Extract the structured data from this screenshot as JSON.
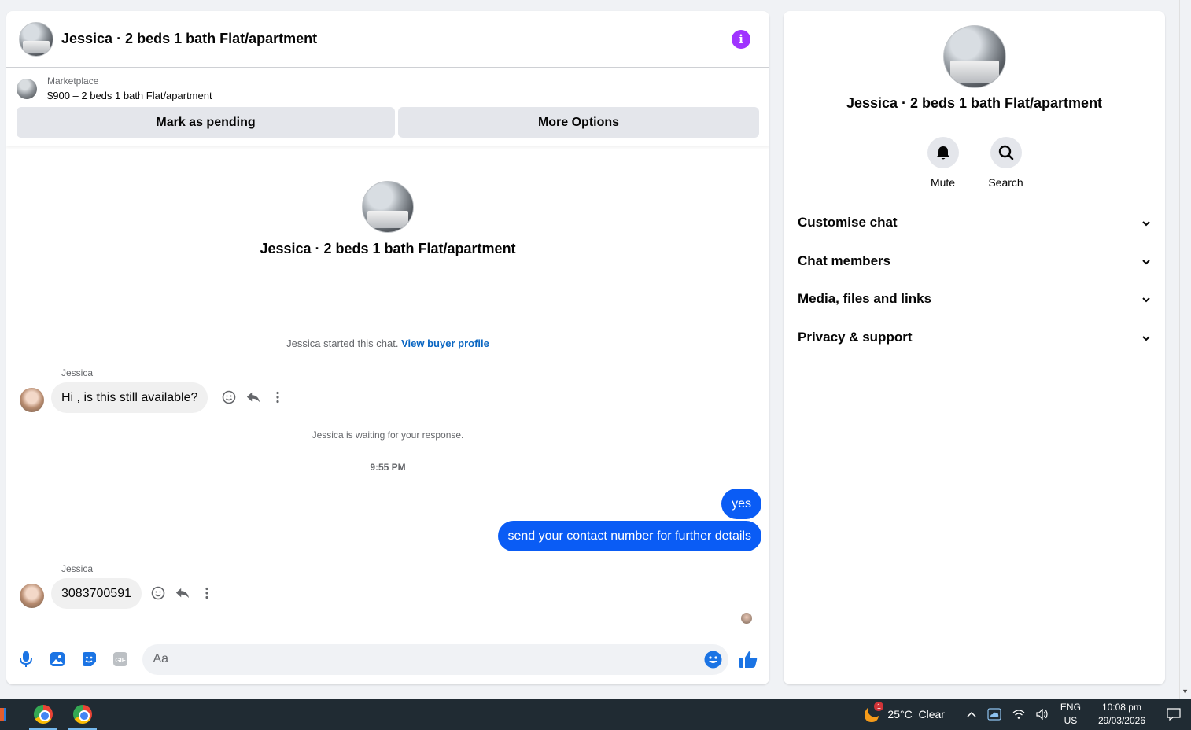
{
  "chat": {
    "title": "Jessica · 2 beds 1 bath Flat/apartment",
    "marketplace": {
      "label": "Marketplace",
      "listing": "$900 – 2 beds 1 bath Flat/apartment",
      "pending_button": "Mark as pending",
      "options_button": "More Options"
    },
    "intro_name": "Jessica · 2 beds 1 bath Flat/apartment",
    "started_text": "Jessica started this chat.",
    "view_profile_link": "View buyer profile",
    "messages": [
      {
        "sender": "Jessica",
        "text": "Hi , is this still available?"
      },
      {
        "sender": "Jessica",
        "text": "3083700591"
      }
    ],
    "waiting_text": "Jessica is waiting for your response.",
    "timestamp": "9:55 PM",
    "outgoing": [
      {
        "text": "yes"
      },
      {
        "text": "send your contact number for further details"
      }
    ],
    "composer_placeholder": "Aa"
  },
  "details": {
    "name": "Jessica · 2 beds 1 bath Flat/apartment",
    "actions": [
      {
        "label": "Mute",
        "icon": "bell-icon"
      },
      {
        "label": "Search",
        "icon": "search-icon"
      }
    ],
    "sections": [
      {
        "label": "Customise chat"
      },
      {
        "label": "Chat members"
      },
      {
        "label": "Media, files and links"
      },
      {
        "label": "Privacy & support"
      }
    ]
  },
  "taskbar": {
    "weather": "25°C  Clear",
    "weather_badge": "1",
    "lang_top": "ENG",
    "lang_bottom": "US",
    "time": "10:08 pm",
    "date": "29/03/2026"
  },
  "colors": {
    "accent": "#0a5cf5",
    "info": "#a033ff",
    "link": "#0a66c2",
    "icon_blue": "#1b74e4"
  }
}
